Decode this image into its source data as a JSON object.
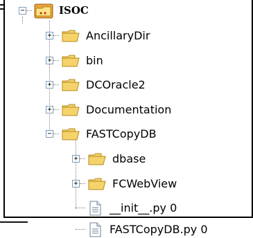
{
  "tree": {
    "root": {
      "label": "ISOC",
      "expanded": true
    },
    "items": [
      {
        "label": "AncillaryDir",
        "type": "folder",
        "expanded": false
      },
      {
        "label": "bin",
        "type": "folder",
        "expanded": false
      },
      {
        "label": "DCOracle2",
        "type": "folder",
        "expanded": false
      },
      {
        "label": "Documentation",
        "type": "folder",
        "expanded": false
      },
      {
        "label": "FASTCopyDB",
        "type": "folder",
        "expanded": true,
        "children": [
          {
            "label": "dbase",
            "type": "folder",
            "expanded": false
          },
          {
            "label": "FCWebView",
            "type": "folder",
            "expanded": false
          },
          {
            "label": "__init__.py 0",
            "type": "file"
          },
          {
            "label": "FASTCopyDB.py 0",
            "type": "file"
          }
        ]
      }
    ]
  },
  "expander_symbols": {
    "expanded": "−",
    "collapsed": "+"
  },
  "colors": {
    "folder_fill": "#f5d26a",
    "folder_stroke": "#b48a1f",
    "connector": "#808080"
  }
}
